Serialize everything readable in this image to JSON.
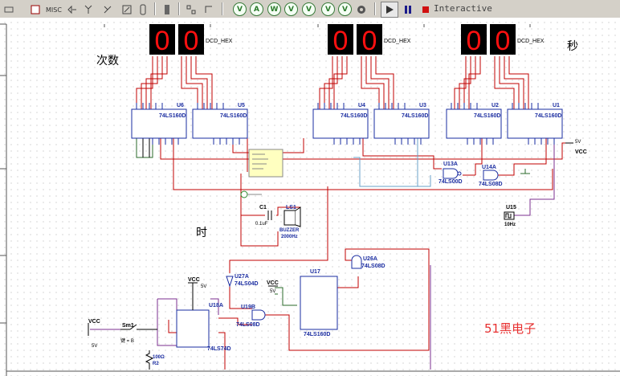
{
  "toolbar": {
    "misc_label": "MISC",
    "interactive_label": "Interactive",
    "sim_buttons": [
      "V",
      "A",
      "W",
      "V",
      "V",
      "V",
      "V",
      "⊘"
    ]
  },
  "canvas": {
    "label_count": "次数",
    "label_second": "秒",
    "label_hour": "时",
    "brand": "51黑电子"
  },
  "displays": {
    "name": "DCD_HEX",
    "digits": [
      "0",
      "0",
      "0",
      "0",
      "0",
      "0"
    ]
  },
  "chips": {
    "counter_part": "74LS160D",
    "counters": [
      "U6",
      "U5",
      "U4",
      "U3",
      "U2",
      "U1"
    ],
    "u13": "U13A",
    "u13_part": "74LS00D",
    "u14": "U14A",
    "u14_part": "74LS08D",
    "u15": "U15",
    "u15_freq": "10Hz",
    "u26": "U26A",
    "u26_part": "74LS08D",
    "u27": "U27A",
    "u27_part": "74LS04D",
    "u19": "U19B",
    "u19_part": "74LS08D",
    "u17": "U17",
    "u17_part": "74LS160D",
    "u18": "U18A",
    "u18_part": "74LS74D"
  },
  "components": {
    "c1": "C1",
    "c1_val": "0.1uF",
    "ls1": "LS1",
    "buzzer": "BUZZER",
    "buzzer_freq": "2000Hz",
    "sm1": "Sm1",
    "sm1_key": "键 = B",
    "r2": "R2",
    "r2_val": "100Ω",
    "vcc": "VCC",
    "v5": "5V"
  }
}
